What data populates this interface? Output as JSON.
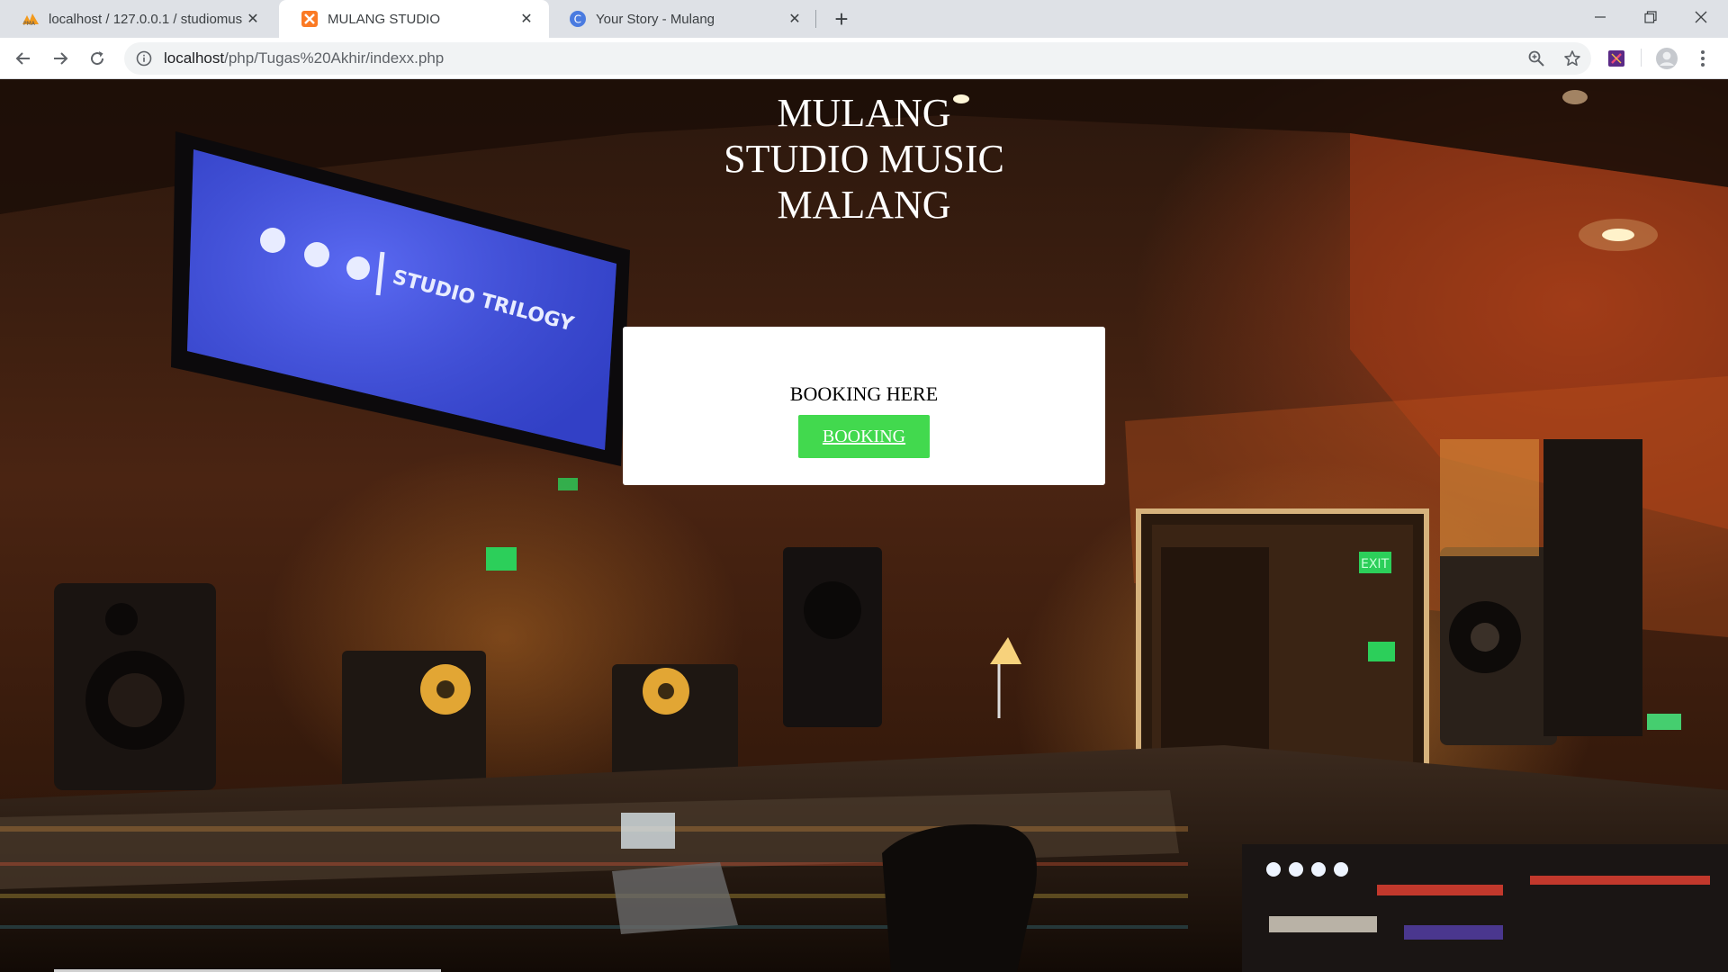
{
  "tabs": [
    {
      "title": "localhost / 127.0.0.1 / studiomusic",
      "icon": "phpmyadmin-icon",
      "close": "✕"
    },
    {
      "title": "MULANG STUDIO",
      "icon": "xampp-icon",
      "close": "✕"
    },
    {
      "title": "Your Story - Mulang",
      "icon": "c-icon",
      "close": "✕"
    }
  ],
  "new_tab": "+",
  "address": {
    "host": "localhost",
    "path": "/php/Tugas%20Akhir/indexx.php"
  },
  "hero": {
    "line1": "MULANG",
    "line2": "STUDIO MUSIC",
    "line3": "MALANG"
  },
  "booking": {
    "label": "BOOKING HERE",
    "button": "BOOKING",
    "button_color": "#42d94e"
  },
  "background": {
    "screen_text": "STUDIO TRILOGY",
    "exit_sign": "EXIT"
  }
}
